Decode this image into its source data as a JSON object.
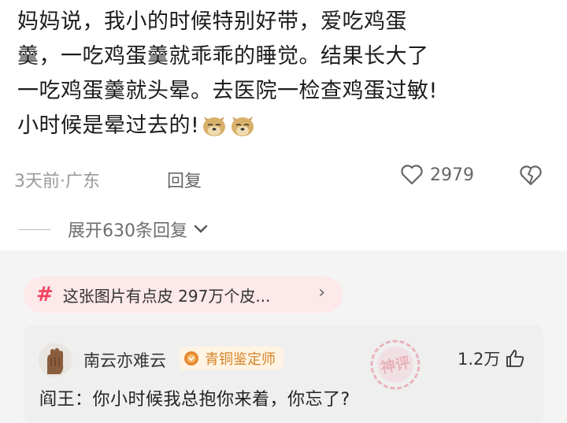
{
  "comment": {
    "lines": [
      "妈妈说，我小的时候特别好带，爱吃鸡蛋",
      "羹，一吃鸡蛋羹就乖乖的睡觉。结果长大了",
      "一吃鸡蛋羹就头晕。去医院一检查鸡蛋过敏!",
      "小时候是晕过去的!"
    ],
    "emoji": "dog-face-emoji",
    "time_location": "3天前·广东",
    "reply_label": "回复",
    "like_count": "2979"
  },
  "expand_label": "展开630条回复",
  "tag": {
    "text": "这张图片有点皮  297万个皮...",
    "arrow": "›"
  },
  "god_comment": {
    "user_name": "南云亦难云",
    "badge": "青铜鉴定师",
    "stamp_text": "神评",
    "like_count": "1.2万",
    "text": "阎王：你小时候我总抱你来着，你忘了?"
  },
  "colors": {
    "accent": "#f0455f",
    "badge": "#d5842b"
  }
}
